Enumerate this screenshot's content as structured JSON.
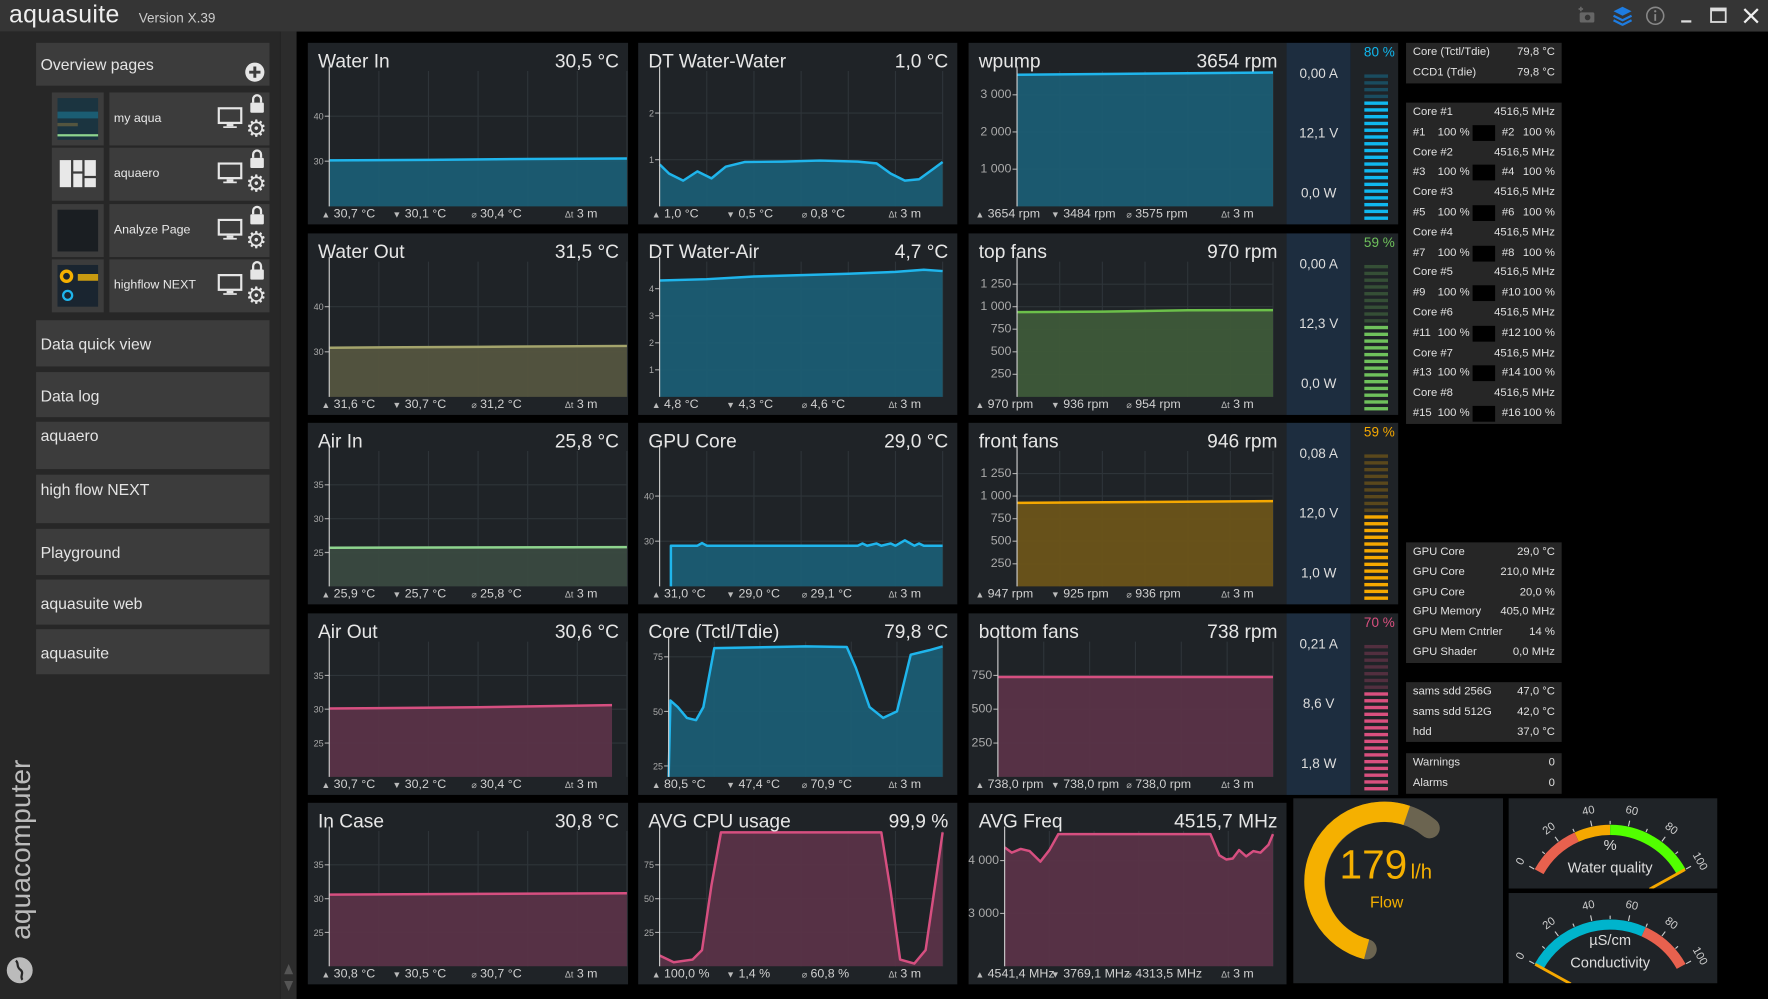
{
  "app": {
    "title": "aquasuite",
    "version": "Version X.39"
  },
  "titlebar": {
    "icons": [
      "camera-icon",
      "layers-icon",
      "info-icon",
      "minimize-icon",
      "maximize-icon",
      "close-icon"
    ],
    "accent": "#1e7ce0"
  },
  "sidebar": {
    "overview_label": "Overview pages",
    "pages": [
      {
        "name": "my aqua"
      },
      {
        "name": "aquaero"
      },
      {
        "name": "Analyze Page"
      },
      {
        "name": "highflow NEXT"
      }
    ],
    "items": [
      "Data quick view",
      "Data log",
      "aquaero",
      "high flow NEXT",
      "Playground",
      "aquasuite web",
      "aquasuite"
    ],
    "brand": "aquacomputer"
  },
  "charts": [
    {
      "title": "Water In",
      "value": "30,5 °C",
      "ymin": 20,
      "ymax": 50,
      "ticks": [
        {
          "v": 30,
          "label": "30"
        },
        {
          "v": 40,
          "label": "40"
        }
      ],
      "color": "#1fb5ec",
      "fill": "#1b5d73",
      "series": [
        [
          0,
          30.2
        ],
        [
          1,
          30.3
        ],
        [
          2,
          30.5
        ],
        [
          3,
          30.6
        ]
      ],
      "footer": {
        "max": "30,7 °C",
        "min": "30,1 °C",
        "avg": "30,4 °C",
        "dt": "3 m"
      }
    },
    {
      "title": "DT Water-Water",
      "value": "1,0 °C",
      "ymin": 0,
      "ymax": 2.9,
      "ticks": [
        {
          "v": 1,
          "label": "1"
        },
        {
          "v": 2,
          "label": "2"
        }
      ],
      "color": "#1fb5ec",
      "fill": "#1b5d73",
      "series": [
        [
          0,
          0.9
        ],
        [
          0.1,
          0.7
        ],
        [
          0.25,
          0.55
        ],
        [
          0.4,
          0.75
        ],
        [
          0.55,
          0.6
        ],
        [
          0.7,
          0.85
        ],
        [
          0.9,
          0.95
        ],
        [
          1.3,
          0.96
        ],
        [
          1.7,
          0.98
        ],
        [
          2.1,
          0.96
        ],
        [
          2.3,
          0.92
        ],
        [
          2.45,
          0.7
        ],
        [
          2.6,
          0.55
        ],
        [
          2.75,
          0.58
        ],
        [
          2.9,
          0.8
        ],
        [
          3,
          0.95
        ]
      ],
      "footer": {
        "max": "1,0 °C",
        "min": "0,5 °C",
        "avg": "0,8 °C",
        "dt": "3 m"
      }
    },
    {
      "title": "wpump",
      "value": "3654 rpm",
      "ymin": 0,
      "ymax": 3640,
      "ticks": [
        {
          "v": 1000,
          "label": "1 000"
        },
        {
          "v": 2000,
          "label": "2 000"
        },
        {
          "v": 3000,
          "label": "3 000"
        }
      ],
      "color": "#1fb5ec",
      "fill": "#1b5d73",
      "series": [
        [
          0,
          3540
        ],
        [
          1,
          3560
        ],
        [
          2,
          3580
        ],
        [
          3,
          3600
        ]
      ],
      "footer": {
        "max": "3654 rpm",
        "min": "3484 rpm",
        "avg": "3575 rpm",
        "dt": "3 m"
      }
    },
    {
      "title": "Water Out",
      "value": "31,5 °C",
      "ymin": 20,
      "ymax": 50,
      "ticks": [
        {
          "v": 30,
          "label": "30"
        },
        {
          "v": 40,
          "label": "40"
        }
      ],
      "color": "#a4a46c",
      "fill": "#54553f",
      "series": [
        [
          0,
          30.9
        ],
        [
          1.5,
          31.1
        ],
        [
          3,
          31.3
        ]
      ],
      "footer": {
        "max": "31,6 °C",
        "min": "30,7 °C",
        "avg": "31,2 °C",
        "dt": "3 m"
      }
    },
    {
      "title": "DT Water-Air",
      "value": "4,7 °C",
      "ymin": 0,
      "ymax": 5,
      "ticks": [
        {
          "v": 1,
          "label": "1"
        },
        {
          "v": 2,
          "label": "2"
        },
        {
          "v": 3,
          "label": "3"
        },
        {
          "v": 4,
          "label": "4"
        }
      ],
      "color": "#1fb5ec",
      "fill": "#1b5d73",
      "series": [
        [
          0,
          4.3
        ],
        [
          0.5,
          4.35
        ],
        [
          1,
          4.45
        ],
        [
          1.5,
          4.5
        ],
        [
          2,
          4.55
        ],
        [
          2.5,
          4.62
        ],
        [
          2.8,
          4.7
        ],
        [
          3,
          4.65
        ]
      ],
      "footer": {
        "max": "4,8 °C",
        "min": "4,3 °C",
        "avg": "4,6 °C",
        "dt": "3 m"
      }
    },
    {
      "title": "top fans",
      "value": "970 rpm",
      "ymin": 0,
      "ymax": 1500,
      "ticks": [
        {
          "v": 250,
          "label": "250"
        },
        {
          "v": 500,
          "label": "500"
        },
        {
          "v": 750,
          "label": "750"
        },
        {
          "v": 1000,
          "label": "1 000"
        },
        {
          "v": 1250,
          "label": "1 250"
        }
      ],
      "color": "#6cc04a",
      "fill": "#3e5a39",
      "series": [
        [
          0,
          940
        ],
        [
          1,
          945
        ],
        [
          2,
          960
        ],
        [
          3,
          962
        ]
      ],
      "footer": {
        "max": "970 rpm",
        "min": "936 rpm",
        "avg": "954 rpm",
        "dt": "3 m"
      }
    },
    {
      "title": "Air In",
      "value": "25,8 °C",
      "ymin": 20,
      "ymax": 40,
      "ticks": [
        {
          "v": 25,
          "label": "25"
        },
        {
          "v": 30,
          "label": "30"
        },
        {
          "v": 35,
          "label": "35"
        }
      ],
      "color": "#8ed48e",
      "fill": "#3a4a40",
      "series": [
        [
          0,
          25.7
        ],
        [
          3,
          25.8
        ]
      ],
      "footer": {
        "max": "25,9 °C",
        "min": "25,7 °C",
        "avg": "25,8 °C",
        "dt": "3 m"
      }
    },
    {
      "title": "GPU Core",
      "value": "29,0 °C",
      "ymin": 20,
      "ymax": 50,
      "ticks": [
        {
          "v": 30,
          "label": "30"
        },
        {
          "v": 40,
          "label": "40"
        }
      ],
      "color": "#1fb5ec",
      "fill": "#1b5d73",
      "series": [
        [
          0.12,
          20
        ],
        [
          0.12,
          29
        ],
        [
          0.4,
          29
        ],
        [
          0.45,
          29.6
        ],
        [
          0.5,
          29
        ],
        [
          2.1,
          29
        ],
        [
          2.15,
          29.5
        ],
        [
          2.2,
          29
        ],
        [
          2.3,
          29.5
        ],
        [
          2.35,
          29
        ],
        [
          2.45,
          29.5
        ],
        [
          2.5,
          29
        ],
        [
          2.6,
          30.2
        ],
        [
          2.7,
          29
        ],
        [
          2.75,
          29.5
        ],
        [
          2.8,
          29
        ],
        [
          3,
          29
        ]
      ],
      "footer": {
        "max": "31,0 °C",
        "min": "29,0 °C",
        "avg": "29,1 °C",
        "dt": "3 m"
      }
    },
    {
      "title": "front fans",
      "value": "946 rpm",
      "ymin": 0,
      "ymax": 1500,
      "ticks": [
        {
          "v": 250,
          "label": "250"
        },
        {
          "v": 500,
          "label": "500"
        },
        {
          "v": 750,
          "label": "750"
        },
        {
          "v": 1000,
          "label": "1 000"
        },
        {
          "v": 1250,
          "label": "1 250"
        }
      ],
      "color": "#f5a800",
      "fill": "#6b5419",
      "series": [
        [
          0,
          925
        ],
        [
          1.5,
          935
        ],
        [
          3,
          945
        ]
      ],
      "footer": {
        "max": "947 rpm",
        "min": "925 rpm",
        "avg": "936 rpm",
        "dt": "3 m"
      }
    },
    {
      "title": "Air Out",
      "value": "30,6 °C",
      "ymin": 20,
      "ymax": 40,
      "ticks": [
        {
          "v": 25,
          "label": "25"
        },
        {
          "v": 30,
          "label": "30"
        },
        {
          "v": 35,
          "label": "35"
        }
      ],
      "color": "#d64f80",
      "fill": "#5a3347",
      "series": [
        [
          0,
          30.1
        ],
        [
          1.5,
          30.3
        ],
        [
          2.85,
          30.6
        ]
      ],
      "footer": {
        "max": "30,7 °C",
        "min": "30,2 °C",
        "avg": "30,4 °C",
        "dt": "3 m"
      }
    },
    {
      "title": "Core (Tctl/Tdie)",
      "value": "79,8 °C",
      "ymin": 20,
      "ymax": 82,
      "ticks": [
        {
          "v": 25,
          "label": "25"
        },
        {
          "v": 50,
          "label": "50"
        },
        {
          "v": 75,
          "label": "75"
        }
      ],
      "color": "#1fb5ec",
      "fill": "#1b5d73",
      "series": [
        [
          0,
          20
        ],
        [
          0.02,
          55
        ],
        [
          0.1,
          52
        ],
        [
          0.2,
          47
        ],
        [
          0.3,
          46
        ],
        [
          0.38,
          52
        ],
        [
          0.5,
          79
        ],
        [
          1.5,
          79.8
        ],
        [
          1.95,
          79.5
        ],
        [
          2.05,
          70
        ],
        [
          2.2,
          52
        ],
        [
          2.35,
          47
        ],
        [
          2.5,
          50
        ],
        [
          2.65,
          76
        ],
        [
          2.85,
          78
        ],
        [
          3,
          79.8
        ]
      ],
      "footer": {
        "max": "80,5 °C",
        "min": "47,4 °C",
        "avg": "70,9 °C",
        "dt": "3 m"
      }
    },
    {
      "title": "bottom fans",
      "value": "738 rpm",
      "ymin": 0,
      "ymax": 1000,
      "ticks": [
        {
          "v": 250,
          "label": "250"
        },
        {
          "v": 500,
          "label": "500"
        },
        {
          "v": 750,
          "label": "750"
        }
      ],
      "color": "#d64f80",
      "fill": "#5a3347",
      "series": [
        [
          0,
          738
        ],
        [
          3,
          738
        ]
      ],
      "footer": {
        "max": "738,0 rpm",
        "min": "738,0 rpm",
        "avg": "738,0 rpm",
        "dt": "3 m"
      }
    },
    {
      "title": "In Case",
      "value": "30,8 °C",
      "ymin": 20,
      "ymax": 40,
      "ticks": [
        {
          "v": 25,
          "label": "25"
        },
        {
          "v": 30,
          "label": "30"
        },
        {
          "v": 35,
          "label": "35"
        }
      ],
      "color": "#d64f80",
      "fill": "#5a3347",
      "series": [
        [
          0,
          30.6
        ],
        [
          1.5,
          30.7
        ],
        [
          3,
          30.8
        ]
      ],
      "footer": {
        "max": "30,8 °C",
        "min": "30,5 °C",
        "avg": "30,7 °C",
        "dt": "3 m"
      }
    },
    {
      "title": "AVG CPU usage",
      "value": "99,9 %",
      "ymin": 0,
      "ymax": 100,
      "ticks": [
        {
          "v": 25,
          "label": "25"
        },
        {
          "v": 50,
          "label": "50"
        },
        {
          "v": 75,
          "label": "75"
        }
      ],
      "color": "#d64f80",
      "fill": "#5a3347",
      "series": [
        [
          0,
          8
        ],
        [
          0.15,
          3
        ],
        [
          0.35,
          5
        ],
        [
          0.45,
          12
        ],
        [
          0.55,
          60
        ],
        [
          0.65,
          99
        ],
        [
          2.35,
          99
        ],
        [
          2.45,
          55
        ],
        [
          2.55,
          5
        ],
        [
          2.7,
          2
        ],
        [
          2.82,
          12
        ],
        [
          2.92,
          60
        ],
        [
          3,
          99
        ]
      ],
      "footer": {
        "max": "100,0 %",
        "min": "1,4 %",
        "avg": "60,8 %",
        "dt": "3 m"
      }
    },
    {
      "title": "AVG Freq",
      "value": "4515,7 MHz",
      "ymin": 2000,
      "ymax": 4560,
      "ticks": [
        {
          "v": 3000,
          "label": "3 000"
        },
        {
          "v": 4000,
          "label": "4 000"
        }
      ],
      "color": "#d64f80",
      "fill": "#5a3347",
      "series": [
        [
          0,
          4250
        ],
        [
          0.08,
          4150
        ],
        [
          0.18,
          4220
        ],
        [
          0.28,
          4180
        ],
        [
          0.4,
          3980
        ],
        [
          0.5,
          4200
        ],
        [
          0.6,
          4500
        ],
        [
          2.3,
          4500
        ],
        [
          2.4,
          4100
        ],
        [
          2.48,
          4020
        ],
        [
          2.55,
          4040
        ],
        [
          2.62,
          4200
        ],
        [
          2.7,
          4080
        ],
        [
          2.78,
          4180
        ],
        [
          2.86,
          4150
        ],
        [
          2.95,
          4300
        ],
        [
          3,
          4500
        ]
      ],
      "footer": {
        "max": "4541,4 MHz",
        "min": "3769,1 MHz",
        "avg": "4313,5 MHz",
        "dt": "3 m"
      }
    }
  ],
  "power": [
    {
      "current": "0,00 A",
      "voltage": "12,1 V",
      "power": "0,0 W",
      "percent": 80,
      "percent_label": "80 %",
      "color": "#10b8ef"
    },
    {
      "current": "0,00 A",
      "voltage": "12,3 V",
      "power": "0,0 W",
      "percent": 59,
      "percent_label": "59 %",
      "color": "#6fc15c"
    },
    {
      "current": "0,08 A",
      "voltage": "12,0 V",
      "power": "1,0 W",
      "percent": 59,
      "percent_label": "59 %",
      "color": "#f5a800"
    },
    {
      "current": "0,21 A",
      "voltage": "8,6 V",
      "power": "1,8 W",
      "percent": 70,
      "percent_label": "70 %",
      "color": "#d9507f"
    }
  ],
  "cpu_panel": [
    {
      "label": "Core (Tctl/Tdie)",
      "value": "79,8 °C"
    },
    {
      "label": "CCD1 (Tdie)",
      "value": "79,8 °C"
    }
  ],
  "cores": [
    {
      "label": "Core #1",
      "freq": "4516,5 MHz",
      "threads": [
        {
          "id": "#1",
          "load": "100 %"
        },
        {
          "id": "#2",
          "load": "100 %"
        }
      ]
    },
    {
      "label": "Core #2",
      "freq": "4516,5 MHz",
      "threads": [
        {
          "id": "#3",
          "load": "100 %"
        },
        {
          "id": "#4",
          "load": "100 %"
        }
      ]
    },
    {
      "label": "Core #3",
      "freq": "4516,5 MHz",
      "threads": [
        {
          "id": "#5",
          "load": "100 %"
        },
        {
          "id": "#6",
          "load": "100 %"
        }
      ]
    },
    {
      "label": "Core #4",
      "freq": "4516,5 MHz",
      "threads": [
        {
          "id": "#7",
          "load": "100 %"
        },
        {
          "id": "#8",
          "load": "100 %"
        }
      ]
    },
    {
      "label": "Core #5",
      "freq": "4516,5 MHz",
      "threads": [
        {
          "id": "#9",
          "load": "100 %"
        },
        {
          "id": "#10",
          "load": "100 %"
        }
      ]
    },
    {
      "label": "Core #6",
      "freq": "4516,5 MHz",
      "threads": [
        {
          "id": "#11",
          "load": "100 %"
        },
        {
          "id": "#12",
          "load": "100 %"
        }
      ]
    },
    {
      "label": "Core #7",
      "freq": "4516,5 MHz",
      "threads": [
        {
          "id": "#13",
          "load": "100 %"
        },
        {
          "id": "#14",
          "load": "100 %"
        }
      ]
    },
    {
      "label": "Core #8",
      "freq": "4516,5 MHz",
      "threads": [
        {
          "id": "#15",
          "load": "100 %"
        },
        {
          "id": "#16",
          "load": "100 %"
        }
      ]
    }
  ],
  "gpu_panel": [
    {
      "label": "GPU Core",
      "value": "29,0 °C"
    },
    {
      "label": "GPU Core",
      "value": "210,0 MHz"
    },
    {
      "label": "GPU Core",
      "value": "20,0 %"
    },
    {
      "label": "GPU Memory",
      "value": "405,0 MHz"
    },
    {
      "label": "GPU Mem Cntrler",
      "value": "14 %"
    },
    {
      "label": "GPU Shader",
      "value": "0,0 MHz"
    }
  ],
  "disk_panel": [
    {
      "label": "sams sdd 256G",
      "value": "47,0 °C"
    },
    {
      "label": "sams sdd 512G",
      "value": "42,0 °C"
    },
    {
      "label": "hdd",
      "value": "37,0 °C"
    }
  ],
  "alert_panel": [
    {
      "label": "Warnings",
      "value": "0"
    },
    {
      "label": "Alarms",
      "value": "0"
    }
  ],
  "flow": {
    "value": "179",
    "value_num": 179,
    "max": 200,
    "unit": "l/h",
    "label": "Flow",
    "color": "#f5b000",
    "track": "#6b6450"
  },
  "gauges": [
    {
      "unit": "%",
      "label": "Water quality",
      "value": 100,
      "tick_labels": [
        "0",
        "20",
        "40",
        "60",
        "80",
        "100"
      ],
      "segments": [
        {
          "from": 0,
          "to": 30,
          "color": "#e8614e"
        },
        {
          "from": 30,
          "to": 50,
          "color": "#f5a800"
        },
        {
          "from": 50,
          "to": 100,
          "color": "#52ff00"
        }
      ],
      "needle": "#f5a800"
    },
    {
      "unit": "µS/cm",
      "label": "Conductivity",
      "value": 0,
      "tick_labels": [
        "0",
        "20",
        "40",
        "60",
        "80",
        "100"
      ],
      "segments": [
        {
          "from": 0,
          "to": 70,
          "color": "#00b4cc"
        },
        {
          "from": 70,
          "to": 100,
          "color": "#e8614e"
        }
      ],
      "needle": "#f5a800"
    }
  ]
}
